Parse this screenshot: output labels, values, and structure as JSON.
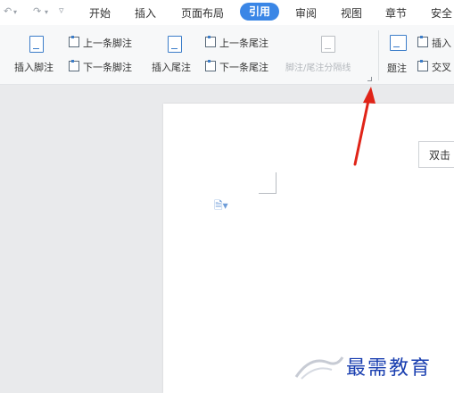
{
  "quick_access": {
    "undo_icon": "undo-icon",
    "redo_icon": "redo-icon",
    "menu_icon": "dropdown-menu-icon"
  },
  "tabs": [
    {
      "label": "开始"
    },
    {
      "label": "插入"
    },
    {
      "label": "页面布局"
    },
    {
      "label": "引用",
      "active": true
    },
    {
      "label": "审阅"
    },
    {
      "label": "视图"
    },
    {
      "label": "章节"
    },
    {
      "label": "安全"
    }
  ],
  "ribbon": {
    "insert_footnote": "插入脚注",
    "prev_footnote": "上一条脚注",
    "next_footnote": "下一条脚注",
    "insert_endnote": "插入尾注",
    "prev_endnote": "上一条尾注",
    "next_endnote": "下一条尾注",
    "separator_line": "脚注/尾注分隔线",
    "caption": "题注",
    "insert_partial": "插入",
    "cross_partial": "交叉"
  },
  "document": {
    "tooltip_text": "双击"
  },
  "watermark": {
    "text": "最需教育"
  },
  "colors": {
    "accent": "#3a86e6",
    "arrow": "#e02418",
    "watermark": "#1a3fb0"
  }
}
